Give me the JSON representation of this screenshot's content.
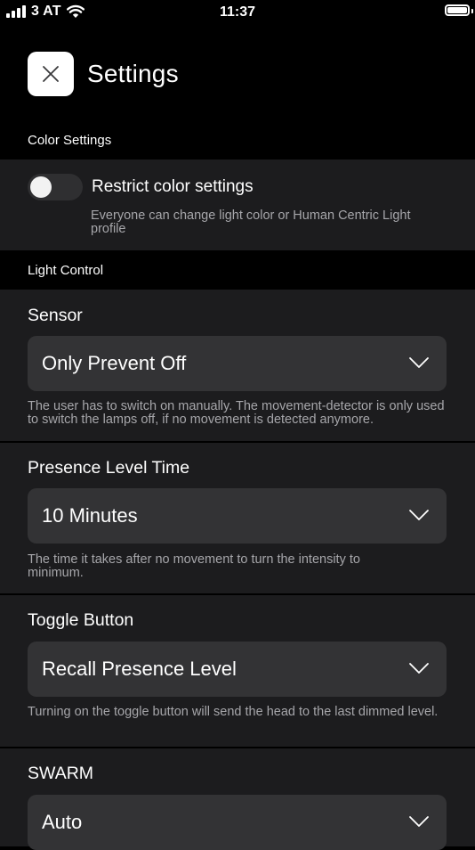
{
  "status_bar": {
    "carrier": "3 AT",
    "time": "11:37"
  },
  "header": {
    "title": "Settings"
  },
  "color_settings": {
    "section_label": "Color Settings",
    "toggle_label": "Restrict color settings",
    "toggle_on": false,
    "help": "Everyone can change light color or Human Centric Light profile"
  },
  "light_control": {
    "section_label": "Light Control",
    "sensor": {
      "label": "Sensor",
      "value": "Only Prevent Off",
      "help": "The user has to switch on manually. The movement-detector is only used to switch the lamps off, if no movement is detected anymore."
    },
    "presence_level_time": {
      "label": "Presence Level Time",
      "value": "10 Minutes",
      "help": "The time it takes after no movement to turn the intensity to minimum."
    },
    "toggle_button": {
      "label": "Toggle Button",
      "value": "Recall Presence Level",
      "help": "Turning on the toggle button will send the head to the last dimmed level."
    },
    "swarm": {
      "label": "SWARM",
      "value": "Auto"
    }
  },
  "colors": {
    "background": "#000000",
    "card": "#1c1c1e",
    "dropdown": "#333335",
    "help_text": "#a6a6aa"
  }
}
